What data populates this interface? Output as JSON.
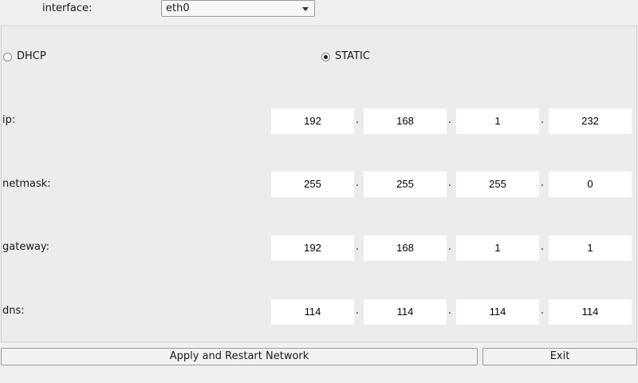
{
  "interface": {
    "label": "interface:",
    "selected": "eth0"
  },
  "mode": {
    "dhcp_label": "DHCP",
    "static_label": "STATIC",
    "selected": "STATIC"
  },
  "rows": {
    "ip": {
      "label": "ip:",
      "octets": [
        "192",
        "168",
        "1",
        "232"
      ]
    },
    "netmask": {
      "label": "netmask:",
      "octets": [
        "255",
        "255",
        "255",
        "0"
      ]
    },
    "gateway": {
      "label": "gateway:",
      "octets": [
        "192",
        "168",
        "1",
        "1"
      ]
    },
    "dns": {
      "label": "dns:",
      "octets": [
        "114",
        "114",
        "114",
        "114"
      ]
    }
  },
  "separator": ".",
  "buttons": {
    "apply": "Apply and Restart Network",
    "exit": "Exit"
  }
}
